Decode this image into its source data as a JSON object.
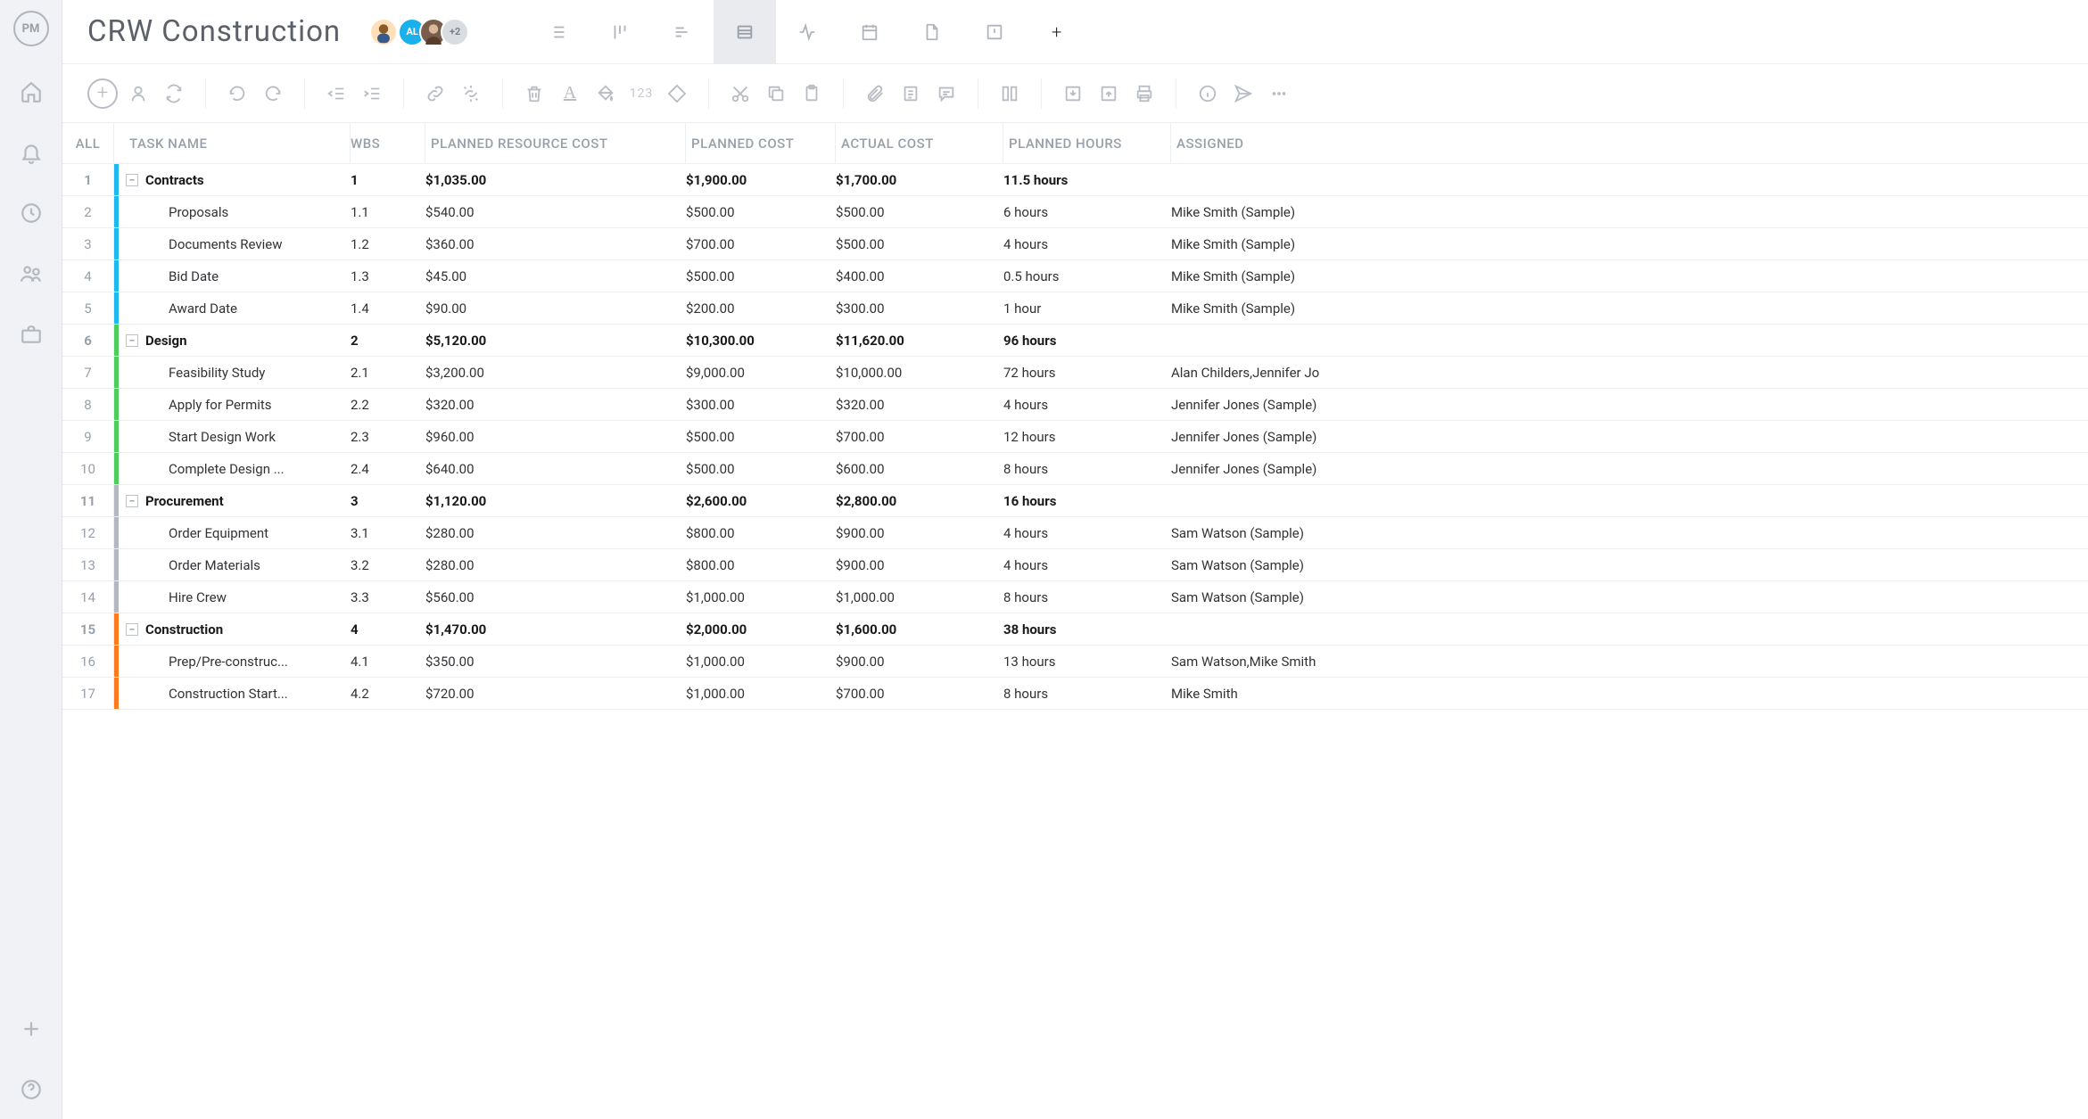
{
  "project_title": "CRW Construction",
  "avatar_more": "+2",
  "avatar_initials": "AL",
  "columns": {
    "all": "ALL",
    "task": "TASK NAME",
    "wbs": "WBS",
    "prc": "PLANNED RESOURCE COST",
    "pc": "PLANNED COST",
    "ac": "ACTUAL COST",
    "ph": "PLANNED HOURS",
    "as": "ASSIGNED"
  },
  "tool_numbers_label": "123",
  "rows": [
    {
      "n": "1",
      "bar": "blue",
      "summary": true,
      "task": "Contracts",
      "wbs": "1",
      "prc": "$1,035.00",
      "pc": "$1,900.00",
      "ac": "$1,700.00",
      "ph": "11.5 hours",
      "as": ""
    },
    {
      "n": "2",
      "bar": "blue",
      "summary": false,
      "task": "Proposals",
      "wbs": "1.1",
      "prc": "$540.00",
      "pc": "$500.00",
      "ac": "$500.00",
      "ph": "6 hours",
      "as": "Mike Smith (Sample)"
    },
    {
      "n": "3",
      "bar": "blue",
      "summary": false,
      "task": "Documents Review",
      "wbs": "1.2",
      "prc": "$360.00",
      "pc": "$700.00",
      "ac": "$500.00",
      "ph": "4 hours",
      "as": "Mike Smith (Sample)"
    },
    {
      "n": "4",
      "bar": "blue",
      "summary": false,
      "task": "Bid Date",
      "wbs": "1.3",
      "prc": "$45.00",
      "pc": "$500.00",
      "ac": "$400.00",
      "ph": "0.5 hours",
      "as": "Mike Smith (Sample)"
    },
    {
      "n": "5",
      "bar": "blue",
      "summary": false,
      "task": "Award Date",
      "wbs": "1.4",
      "prc": "$90.00",
      "pc": "$200.00",
      "ac": "$300.00",
      "ph": "1 hour",
      "as": "Mike Smith (Sample)"
    },
    {
      "n": "6",
      "bar": "green",
      "summary": true,
      "task": "Design",
      "wbs": "2",
      "prc": "$5,120.00",
      "pc": "$10,300.00",
      "ac": "$11,620.00",
      "ph": "96 hours",
      "as": ""
    },
    {
      "n": "7",
      "bar": "green",
      "summary": false,
      "task": "Feasibility Study",
      "wbs": "2.1",
      "prc": "$3,200.00",
      "pc": "$9,000.00",
      "ac": "$10,000.00",
      "ph": "72 hours",
      "as": "Alan Childers,Jennifer Jo"
    },
    {
      "n": "8",
      "bar": "green",
      "summary": false,
      "task": "Apply for Permits",
      "wbs": "2.2",
      "prc": "$320.00",
      "pc": "$300.00",
      "ac": "$320.00",
      "ph": "4 hours",
      "as": "Jennifer Jones (Sample)"
    },
    {
      "n": "9",
      "bar": "green",
      "summary": false,
      "task": "Start Design Work",
      "wbs": "2.3",
      "prc": "$960.00",
      "pc": "$500.00",
      "ac": "$700.00",
      "ph": "12 hours",
      "as": "Jennifer Jones (Sample)"
    },
    {
      "n": "10",
      "bar": "green",
      "summary": false,
      "task": "Complete Design ...",
      "wbs": "2.4",
      "prc": "$640.00",
      "pc": "$500.00",
      "ac": "$600.00",
      "ph": "8 hours",
      "as": "Jennifer Jones (Sample)"
    },
    {
      "n": "11",
      "bar": "grey",
      "summary": true,
      "task": "Procurement",
      "wbs": "3",
      "prc": "$1,120.00",
      "pc": "$2,600.00",
      "ac": "$2,800.00",
      "ph": "16 hours",
      "as": ""
    },
    {
      "n": "12",
      "bar": "grey",
      "summary": false,
      "task": "Order Equipment",
      "wbs": "3.1",
      "prc": "$280.00",
      "pc": "$800.00",
      "ac": "$900.00",
      "ph": "4 hours",
      "as": "Sam Watson (Sample)"
    },
    {
      "n": "13",
      "bar": "grey",
      "summary": false,
      "task": "Order Materials",
      "wbs": "3.2",
      "prc": "$280.00",
      "pc": "$800.00",
      "ac": "$900.00",
      "ph": "4 hours",
      "as": "Sam Watson (Sample)"
    },
    {
      "n": "14",
      "bar": "grey",
      "summary": false,
      "task": "Hire Crew",
      "wbs": "3.3",
      "prc": "$560.00",
      "pc": "$1,000.00",
      "ac": "$1,000.00",
      "ph": "8 hours",
      "as": "Sam Watson (Sample)"
    },
    {
      "n": "15",
      "bar": "orange",
      "summary": true,
      "task": "Construction",
      "wbs": "4",
      "prc": "$1,470.00",
      "pc": "$2,000.00",
      "ac": "$1,600.00",
      "ph": "38 hours",
      "as": ""
    },
    {
      "n": "16",
      "bar": "orange",
      "summary": false,
      "task": "Prep/Pre-construc...",
      "wbs": "4.1",
      "prc": "$350.00",
      "pc": "$1,000.00",
      "ac": "$900.00",
      "ph": "13 hours",
      "as": "Sam Watson,Mike Smith"
    },
    {
      "n": "17",
      "bar": "orange",
      "summary": false,
      "task": "Construction Start...",
      "wbs": "4.2",
      "prc": "$720.00",
      "pc": "$1,000.00",
      "ac": "$700.00",
      "ph": "8 hours",
      "as": "Mike Smith"
    }
  ]
}
